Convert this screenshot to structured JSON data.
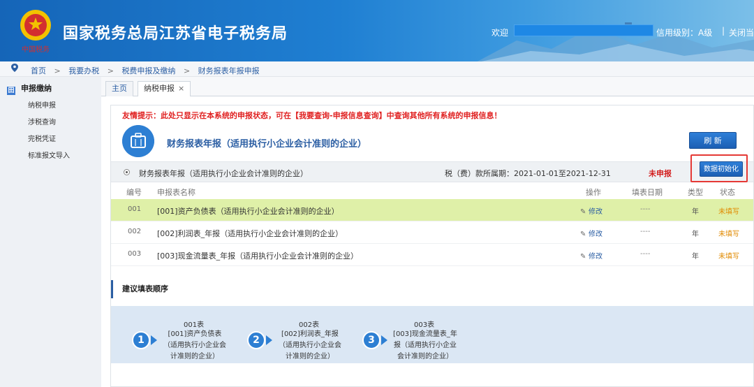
{
  "header": {
    "site_title": "国家税务总局江苏省电子税务局",
    "welcome": "欢迎",
    "credit": "信用级别：A级",
    "separator": "|",
    "close": "关闭当"
  },
  "breadcrumb": {
    "items": [
      "首页",
      "我要办税",
      "税费申报及缴纳",
      "财务报表年报申报"
    ],
    "sep": ">"
  },
  "sidebar": {
    "header": "申报缴纳",
    "header_icon": "田",
    "items": [
      "纳税申报",
      "涉税查询",
      "完税凭证",
      "标准报文导入"
    ]
  },
  "tabs": [
    {
      "label": "主页"
    },
    {
      "label": "纳税申报",
      "close": "×"
    }
  ],
  "tip": "友情提示：此处只显示在本系统的申报状态，可在【我要查询-申报信息查询】中查询其他所有系统的申报信息！",
  "page_title": "财务报表年报（适用执行小企业会计准则的企业）",
  "refresh_button": "刷 新",
  "period": {
    "label": "财务报表年报（适用执行小企业会计准则的企业）",
    "range": "税（费）款所属期：2021-01-01至2021-12-31",
    "status": "未申报",
    "init_button": "数据初始化"
  },
  "table": {
    "headers": [
      "编号",
      "申报表名称",
      "操作",
      "填表日期",
      "类型",
      "状态"
    ],
    "rows": [
      {
        "no": "001",
        "name": "[001]资产负债表（适用执行小企业会计准则的企业）",
        "op": "修改",
        "date": "----",
        "type": "年",
        "status": "未填写",
        "highlight": true
      },
      {
        "no": "002",
        "name": "[002]利润表_年报（适用执行小企业会计准则的企业）",
        "op": "修改",
        "date": "----",
        "type": "年",
        "status": "未填写",
        "highlight": false
      },
      {
        "no": "003",
        "name": "[003]现金流量表_年报（适用执行小企业会计准则的企业）",
        "op": "修改",
        "date": "----",
        "type": "年",
        "status": "未填写",
        "highlight": false
      }
    ]
  },
  "order": {
    "title": "建议填表顺序",
    "steps": [
      {
        "num": "1",
        "code": "001表",
        "desc": "[001]资产负债表（适用执行小企业会计准则的企业）"
      },
      {
        "num": "2",
        "code": "002表",
        "desc": "[002]利润表_年报（适用执行小企业会计准则的企业）"
      },
      {
        "num": "3",
        "code": "003表",
        "desc": "[003]现金流量表_年报（适用执行小企业会计准则的企业）"
      }
    ]
  },
  "colors": {
    "header_blue": "#1f7fd2",
    "accent": "#2d7fd3",
    "warning_red": "#e02020",
    "row_highlight": "#dff0a8",
    "status_orange": "#e08a00"
  }
}
